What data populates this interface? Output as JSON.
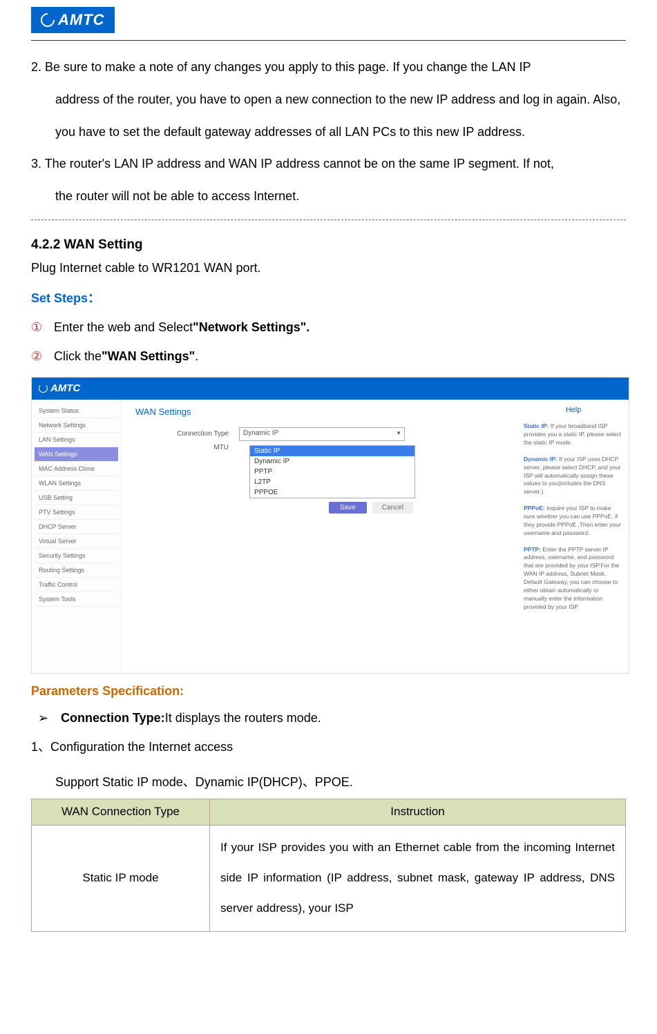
{
  "logo_text": "AMTC",
  "notes": {
    "note2_lead": "2. Be sure to make a note of any changes you apply to this page. If you change the LAN IP",
    "note2_cont": "address of the router, you have to open a new connection to the new IP address and log in again. Also, you have to set the default gateway addresses of all LAN PCs to this new IP address.",
    "note3_lead": "3. The router's LAN IP address and WAN IP address cannot be on the same IP segment. If not,",
    "note3_cont": "the router will not be able to access Internet."
  },
  "section_title": "4.2.2 WAN Setting",
  "section_intro": "Plug Internet cable to WR1201 WAN port.",
  "set_steps_label": "Set Steps：",
  "step1_circ": "①",
  "step1_a": "Enter the web and Select",
  "step1_b": "\"Network Settings\".",
  "step2_circ": "②",
  "step2_a": "Click the",
  "step2_b": "\"WAN Settings\"",
  "step2_c": ".",
  "shot": {
    "sidebar": [
      "System Status",
      "Network Settings",
      "LAN Settings",
      "WAN Settings",
      "MAC Address Clone",
      "WLAN Settings",
      "USB Setting",
      "PTV Settings",
      "DHCP Server",
      "Virtual Server",
      "Security Settings",
      "Routing Settings",
      "Traffic Control",
      "System Tools"
    ],
    "active_index": 3,
    "panel_title": "WAN Settings",
    "label_conn": "Connection Type",
    "label_mtu": "MTU",
    "sel_value": "Dynamic IP",
    "drop_options": [
      "Static IP",
      "Dynamic IP",
      "PPTP",
      "L2TP",
      "PPPOE"
    ],
    "drop_selected": 0,
    "btn_save": "Save",
    "btn_cancel": "Cancel",
    "help_title": "Help",
    "help_static_b": "Static IP:",
    "help_static": " If your broadband ISP provides you a static IP, please select the static IP mode.",
    "help_dyn_b": "Dynamic IP:",
    "help_dyn": " If your ISP uses DHCP server, please select DHCP, and your ISP will automatically assign these values to you(includes the DNS server.)",
    "help_pppoe_b": "PPPoE:",
    "help_pppoe": " Inquire your ISP to make sure whether you can use PPPoE, if they provide PPPoE ,Then enter your username and password.",
    "help_pptp_b": "PPTP:",
    "help_pptp": " Enter the PPTP server IP address, username, and password that are provided by your ISP.For the WAN IP address, Subnet Mask, Default Gateway, you can choose to either obtain automatically or manually enter the information provided by your ISP."
  },
  "params_label": "Parameters Specification:",
  "conn_arrow": "➢",
  "conn_label": "Connection Type:",
  "conn_desc": "It displays the routers mode.",
  "cfg_line": "1、Configuration the Internet access",
  "cfg_support": "Support Static IP mode、Dynamic IP(DHCP)、PPOE.",
  "table": {
    "h1": "WAN Connection Type",
    "h2": "Instruction",
    "r1c1": "Static IP mode",
    "r1c2": "If your ISP provides you with an Ethernet cable from the incoming Internet side IP information (IP address, subnet mask, gateway IP address, DNS server address), your ISP"
  }
}
